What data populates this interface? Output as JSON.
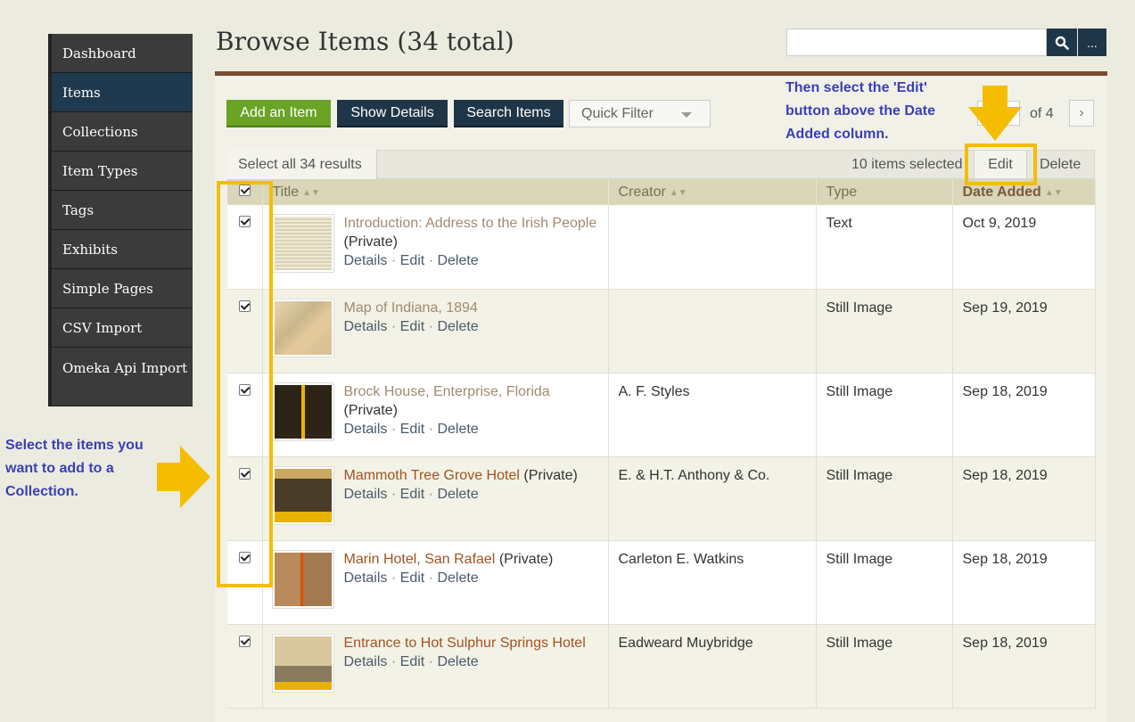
{
  "sidebar": {
    "items": [
      {
        "label": "Dashboard"
      },
      {
        "label": "Items"
      },
      {
        "label": "Collections"
      },
      {
        "label": "Item Types"
      },
      {
        "label": "Tags"
      },
      {
        "label": "Exhibits"
      },
      {
        "label": "Simple Pages"
      },
      {
        "label": "CSV Import"
      },
      {
        "label": "Omeka Api Import"
      }
    ],
    "active": "Items"
  },
  "header": {
    "title": "Browse Items (34 total)",
    "search_placeholder": "",
    "search_icon": "search-icon",
    "advanced_label": "..."
  },
  "toolbar": {
    "add_label": "Add an Item",
    "show_details_label": "Show Details",
    "search_items_label": "Search Items",
    "quick_filter_label": "Quick Filter",
    "page_of": "of 4",
    "next_label": "›"
  },
  "batch": {
    "select_all_label": "Select all 34 results",
    "selected_count": "10 items selected",
    "edit_label": "Edit",
    "delete_label": "Delete"
  },
  "table": {
    "columns": [
      "Title",
      "Creator",
      "Type",
      "Date Added"
    ],
    "actions": {
      "details": "Details",
      "edit": "Edit",
      "delete": "Delete",
      "sep": "·"
    },
    "rows": [
      {
        "title": "Introduction: Address to the Irish People",
        "private": "(Private)",
        "creator": "",
        "type": "Text",
        "date": "Oct 9, 2019"
      },
      {
        "title": "Map of Indiana, 1894",
        "private": "",
        "creator": "",
        "type": "Still Image",
        "date": "Sep 19, 2019"
      },
      {
        "title": "Brock House, Enterprise, Florida",
        "private": "(Private)",
        "creator": "A. F. Styles",
        "type": "Still Image",
        "date": "Sep 18, 2019"
      },
      {
        "title": "Mammoth Tree Grove Hotel",
        "private": "(Private)",
        "creator": "E. & H.T. Anthony & Co.",
        "type": "Still Image",
        "date": "Sep 18, 2019"
      },
      {
        "title": "Marin Hotel, San Rafael",
        "private": "(Private)",
        "creator": "Carleton E. Watkins",
        "type": "Still Image",
        "date": "Sep 18, 2019"
      },
      {
        "title": "Entrance to Hot Sulphur Springs Hotel",
        "private": "",
        "creator": "Eadweard Muybridge",
        "type": "Still Image",
        "date": "Sep 18, 2019"
      }
    ]
  },
  "annotations": {
    "top": "Then select the 'Edit' button above the Date Added column.",
    "left": "Select the items you want to add to a Collection."
  },
  "colors": {
    "annotation": "#3a3fb5",
    "highlight": "#f5bd00",
    "add_button": "#6aa325",
    "dark_button": "#1e3648"
  }
}
